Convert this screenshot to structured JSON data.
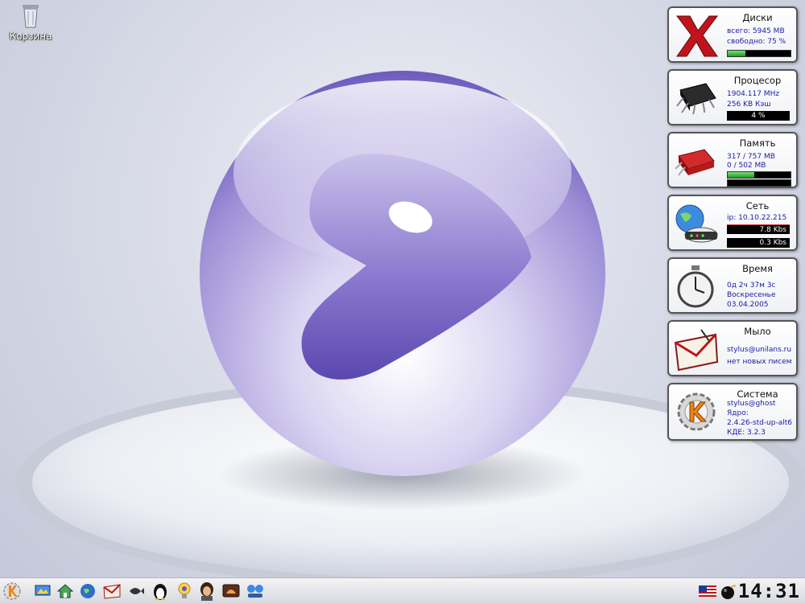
{
  "desktop": {
    "trash_label": "Корзина"
  },
  "widgets": {
    "disks": {
      "title": "Диски",
      "line1": "всего: 5945 MB",
      "line2": "свободно: 75 %",
      "free_fraction": 0.28
    },
    "cpu": {
      "title": "Процесор",
      "line1": "1904.117 MHz",
      "line2": "256 KB   Кэш",
      "load": "4 %"
    },
    "memory": {
      "title": "Память",
      "line1": "317 / 757 MB",
      "line2": "0 / 502 MB",
      "ram_fraction": 0.42,
      "swap_fraction": 0.0
    },
    "network": {
      "title": "Сеть",
      "line1": "ip: 10.10.22.215",
      "down": "7.8 Kbs",
      "up": "0.3 Kbs"
    },
    "time": {
      "title": "Время",
      "line1": "0д 2ч 37м 3с",
      "line2": "Воскресенье",
      "line3": "03.04.2005"
    },
    "mail": {
      "title": "Мыло",
      "line1": "stylus@unilans.ru",
      "line2": "нет новых писем"
    },
    "system": {
      "title": "Система",
      "line1": "stylus@ghost",
      "line2": "Ядро:",
      "line3": "2.4.26-std-up-alt6",
      "line4": "КДЕ: 3.2.3"
    }
  },
  "taskbar": {
    "clock": "14:31",
    "launchers": [
      "kde-menu-icon",
      "desktop-icon",
      "home-icon",
      "browser-icon",
      "mail-icon",
      "fish-icon",
      "tux-icon",
      "lightbulb-icon",
      "user-face-icon",
      "shell-icon",
      "network-icon"
    ],
    "tray": [
      "us-flag-icon",
      "bomb-icon"
    ]
  },
  "colors": {
    "accent": "#6a5ab8",
    "widget_text": "#1a1aa6",
    "bar_fill": "#1c9a1c"
  }
}
